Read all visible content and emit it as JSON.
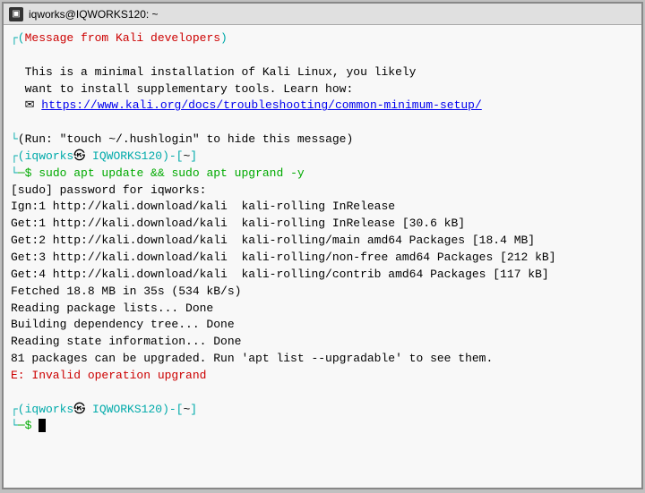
{
  "titlebar": {
    "title": "iqworks@IQWORKS120: ~",
    "icon": "▣"
  },
  "terminal": {
    "lines": [
      {
        "type": "prompt-line",
        "segments": [
          {
            "text": "┌",
            "class": "cyan"
          },
          {
            "text": "(",
            "class": "cyan"
          },
          {
            "text": "Message from Kali developers",
            "class": "red"
          },
          {
            "text": ")",
            "class": "cyan"
          }
        ]
      },
      {
        "type": "blank"
      },
      {
        "type": "plain",
        "text": "  This is a minimal installation of Kali Linux, you likely"
      },
      {
        "type": "plain",
        "text": "  want to install supplementary tools. Learn how:"
      },
      {
        "type": "link-line",
        "prefix": "  ✉ ",
        "link": "https://www.kali.org/docs/troubleshooting/common-minimum-setup/"
      },
      {
        "type": "blank"
      },
      {
        "type": "bottom-message",
        "text": "└(Run: \"touch ~/.hushlogin\" to hide this message)"
      },
      {
        "type": "prompt",
        "user": "iqworks",
        "host": "IQWORKS120",
        "path": "~"
      },
      {
        "type": "command",
        "text": "sudo apt update && sudo apt upgrand -y"
      },
      {
        "type": "plain",
        "text": "[sudo] password for iqworks:"
      },
      {
        "type": "plain",
        "text": "Ign:1 http://kali.download/kali  kali-rolling InRelease"
      },
      {
        "type": "plain",
        "text": "Get:1 http://kali.download/kali  kali-rolling InRelease [30.6 kB]"
      },
      {
        "type": "plain",
        "text": "Get:2 http://kali.download/kali  kali-rolling/main amd64 Packages [18.4 MB]"
      },
      {
        "type": "plain",
        "text": "Get:3 http://kali.download/kali  kali-rolling/non-free amd64 Packages [212 kB]"
      },
      {
        "type": "plain",
        "text": "Get:4 http://kali.download/kali  kali-rolling/contrib amd64 Packages [117 kB]"
      },
      {
        "type": "plain",
        "text": "Fetched 18.8 MB in 35s (534 kB/s)"
      },
      {
        "type": "plain",
        "text": "Reading package lists... Done"
      },
      {
        "type": "plain",
        "text": "Building dependency tree... Done"
      },
      {
        "type": "plain",
        "text": "Reading state information... Done"
      },
      {
        "type": "plain",
        "text": "81 packages can be upgraded. Run 'apt list --upgradable' to see them."
      },
      {
        "type": "error",
        "text": "E: Invalid operation upgrand"
      },
      {
        "type": "blank"
      },
      {
        "type": "prompt",
        "user": "iqworks",
        "host": "IQWORKS120",
        "path": "~"
      },
      {
        "type": "cursor"
      }
    ]
  }
}
